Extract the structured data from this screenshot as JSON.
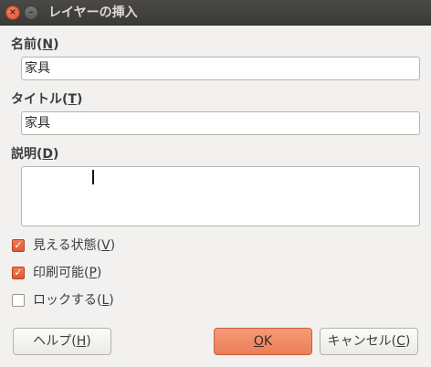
{
  "window": {
    "title": "レイヤーの挿入"
  },
  "form": {
    "name_label": "名前",
    "name_mnemonic": "N",
    "name_value": "家具",
    "title_label": "タイトル",
    "title_mnemonic": "T",
    "title_value": "家具",
    "desc_label": "説明",
    "desc_mnemonic": "D",
    "desc_value": ""
  },
  "options": [
    {
      "label": "見える状態",
      "mnemonic": "V",
      "checked": true
    },
    {
      "label": "印刷可能",
      "mnemonic": "P",
      "checked": true
    },
    {
      "label": "ロックする",
      "mnemonic": "L",
      "checked": false
    }
  ],
  "buttons": {
    "help_label": "ヘルプ",
    "help_mnemonic": "H",
    "ok_label": "OK",
    "ok_mnemonic": "O",
    "cancel_label": "キャンセル",
    "cancel_mnemonic": "C"
  },
  "colors": {
    "accent": "#ea7f58",
    "checkbox_checked": "#dd5a33",
    "titlebar": "#3c3b37",
    "background": "#f2f1f0"
  },
  "icons": {
    "close": "close-icon",
    "minimize": "minimize-icon",
    "check": "checkmark-icon"
  }
}
